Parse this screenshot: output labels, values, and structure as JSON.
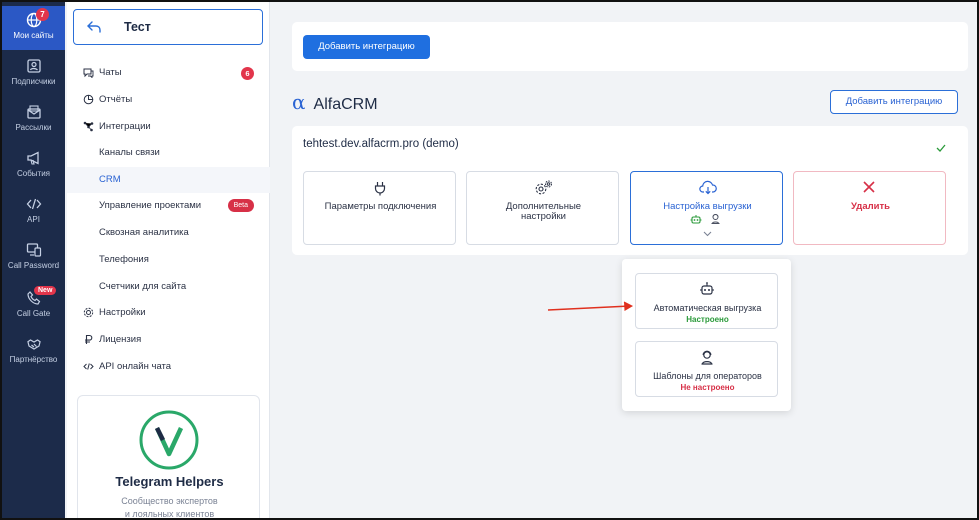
{
  "rail": {
    "items": [
      {
        "label": "Мои сайты",
        "icon": "globe-icon",
        "badge": "7",
        "active": true
      },
      {
        "label": "Подписчики",
        "icon": "contact-card-icon"
      },
      {
        "label": "Рассылки",
        "icon": "mail-icon"
      },
      {
        "label": "События",
        "icon": "megaphone-icon"
      },
      {
        "label": "API",
        "icon": "code-icon"
      },
      {
        "label": "Call Password",
        "icon": "devices-icon"
      },
      {
        "label": "Call Gate",
        "icon": "phone-icon",
        "badge": "New"
      },
      {
        "label": "Партнёрство",
        "icon": "handshake-icon"
      }
    ]
  },
  "sidebar": {
    "back_title": "Тест",
    "items": [
      {
        "label": "Чаты",
        "icon": "chat-icon",
        "count": "6"
      },
      {
        "label": "Отчёты",
        "icon": "chart-pie-icon"
      },
      {
        "label": "Интеграции",
        "icon": "integrations-icon"
      },
      {
        "label": "Каналы связи"
      },
      {
        "label": "CRM",
        "selected": true
      },
      {
        "label": "Управление проектами",
        "tag": "Beta"
      },
      {
        "label": "Сквозная аналитика"
      },
      {
        "label": "Телефония"
      },
      {
        "label": "Счетчики для сайта"
      },
      {
        "label": "Настройки",
        "icon": "gear-icon"
      },
      {
        "label": "Лицензия",
        "icon": "ruble-icon"
      },
      {
        "label": "API онлайн чата",
        "icon": "code-icon"
      }
    ],
    "promo": {
      "title": "Telegram Helpers",
      "subtitle_line1": "Сообщество экспертов",
      "subtitle_line2": "и лояльных клиентов"
    }
  },
  "main": {
    "add_integration_top": "Добавить интеграцию",
    "section_title": "AlfaCRM",
    "section_logo": "α",
    "add_integration_section": "Добавить интеграцию",
    "integration": {
      "name": "tehtest.dev.alfacrm.pro (demo)",
      "tiles": [
        {
          "line1": "Параметры подключения",
          "line2": "",
          "icon": "plug-icon"
        },
        {
          "line1": "Дополнительные",
          "line2": "настройки",
          "icon": "gears-icon"
        },
        {
          "line1": "Настройка выгрузки",
          "line2": "",
          "icon": "cloud-download-icon"
        },
        {
          "line1": "Удалить",
          "line2": "",
          "icon": "close-icon"
        }
      ]
    },
    "dropdown": [
      {
        "label": "Автоматическая выгрузка",
        "status": "Настроено",
        "icon": "robot-icon"
      },
      {
        "label": "Шаблоны для операторов",
        "status": "Не настроено",
        "icon": "operator-icon"
      }
    ]
  },
  "colors": {
    "rail_bg": "#1c2b4a",
    "accent": "#1f6fe0",
    "danger": "#d73047",
    "success": "#2a9a3a"
  }
}
